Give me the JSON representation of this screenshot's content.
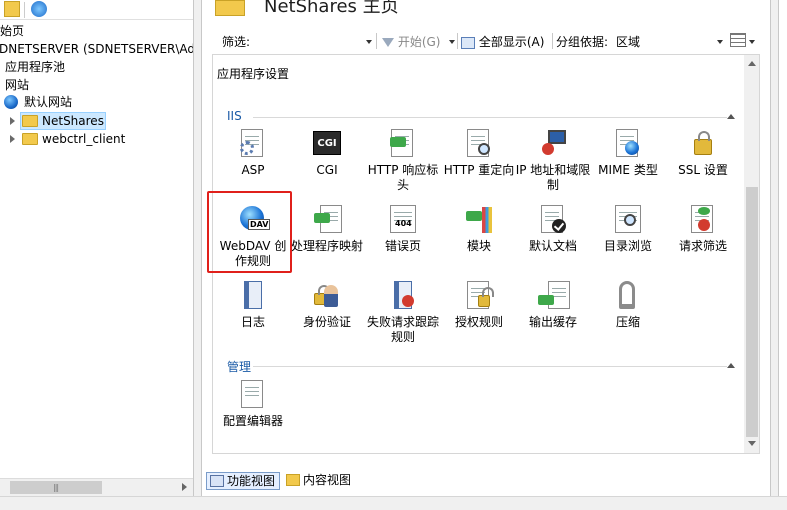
{
  "tree": {
    "start_page": "始页",
    "server": "DNETSERVER (SDNETSERVER\\Adm",
    "app_pools": "应用程序池",
    "sites": "网站",
    "default_site": "默认网站",
    "children": [
      "NetShares",
      "webctrl_client"
    ]
  },
  "main": {
    "title": "NetShares 主页",
    "filter": {
      "label": "筛选:",
      "start": "开始(G)",
      "show_all": "全部显示(A)",
      "group_by_label": "分组依据:",
      "group_by_value": "区域"
    },
    "top_feature": "应用程序设置",
    "groups": [
      {
        "name": "IIS",
        "features": [
          {
            "label": "ASP",
            "icon": "asp-icon"
          },
          {
            "label": "CGI",
            "icon": "cgi-icon"
          },
          {
            "label": "HTTP 响应标头",
            "icon": "http-response-headers-icon"
          },
          {
            "label": "HTTP 重定向",
            "icon": "http-redirect-icon"
          },
          {
            "label": "IP 地址和域限制",
            "icon": "ip-domain-restrictions-icon"
          },
          {
            "label": "MIME 类型",
            "icon": "mime-types-icon"
          },
          {
            "label": "SSL 设置",
            "icon": "ssl-lock-icon"
          },
          {
            "label": "WebDAV 创作规则",
            "icon": "webdav-icon"
          },
          {
            "label": "处理程序映射",
            "icon": "handler-mappings-icon"
          },
          {
            "label": "错误页",
            "icon": "error-pages-icon"
          },
          {
            "label": "模块",
            "icon": "modules-icon"
          },
          {
            "label": "默认文档",
            "icon": "default-document-icon"
          },
          {
            "label": "目录浏览",
            "icon": "directory-browsing-icon"
          },
          {
            "label": "请求筛选",
            "icon": "request-filtering-icon"
          },
          {
            "label": "日志",
            "icon": "logging-icon"
          },
          {
            "label": "身份验证",
            "icon": "authentication-icon"
          },
          {
            "label": "失败请求跟踪规则",
            "icon": "failed-request-tracing-icon"
          },
          {
            "label": "授权规则",
            "icon": "authorization-rules-icon"
          },
          {
            "label": "输出缓存",
            "icon": "output-caching-icon"
          },
          {
            "label": "压缩",
            "icon": "compression-icon"
          }
        ]
      },
      {
        "name": "管理",
        "features": [
          {
            "label": "配置编辑器",
            "icon": "configuration-editor-icon"
          }
        ]
      }
    ],
    "error_page_tag": "404",
    "webdav_tag": "DAV",
    "cgi_tag": "CGI"
  },
  "bottom_tabs": {
    "features_view": "功能视图",
    "content_view": "内容视图"
  }
}
